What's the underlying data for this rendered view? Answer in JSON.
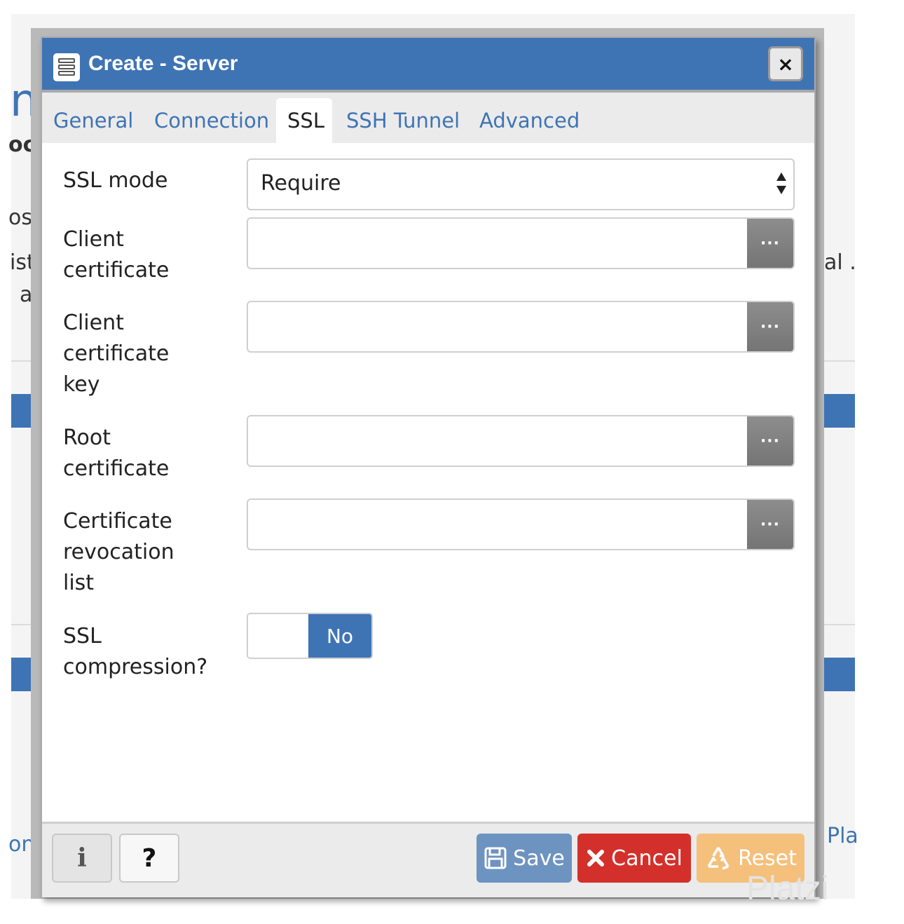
{
  "background": {
    "fragments": {
      "left_1": "n",
      "left_2": "oc",
      "left_3": "os",
      "left_4": "ist",
      "left_5": "a",
      "left_6": "on",
      "right_1": "al .",
      "right_2": "Pla"
    }
  },
  "dialog": {
    "title": "Create - Server",
    "close_label": "×",
    "tabs": [
      {
        "label": "General",
        "active": false
      },
      {
        "label": "Connection",
        "active": false
      },
      {
        "label": "SSL",
        "active": true
      },
      {
        "label": "SSH Tunnel",
        "active": false
      },
      {
        "label": "Advanced",
        "active": false
      }
    ],
    "fields": {
      "ssl_mode": {
        "label": "SSL mode",
        "value": "Require"
      },
      "client_certificate": {
        "label_line1": "Client",
        "label_line2": "certificate",
        "value": "",
        "browse_label": "···"
      },
      "client_certificate_key": {
        "label_line1": "Client",
        "label_line2": "certificate",
        "label_line3": "key",
        "value": "",
        "browse_label": "···"
      },
      "root_certificate": {
        "label_line1": "Root",
        "label_line2": "certificate",
        "value": "",
        "browse_label": "···"
      },
      "crl": {
        "label_line1": "Certificate",
        "label_line2": "revocation",
        "label_line3": "list",
        "value": "",
        "browse_label": "···"
      },
      "ssl_compression": {
        "label_line1": "SSL",
        "label_line2": "compression?",
        "value": "No"
      }
    },
    "footer": {
      "info_label": "i",
      "help_label": "?",
      "save_label": "Save",
      "cancel_label": "Cancel",
      "reset_label": "Reset"
    }
  },
  "watermark": "Platzi",
  "colors": {
    "header_blue": "#3f74b4",
    "save": "#6d93c1",
    "cancel": "#d4302b",
    "reset": "#f4c07c"
  }
}
